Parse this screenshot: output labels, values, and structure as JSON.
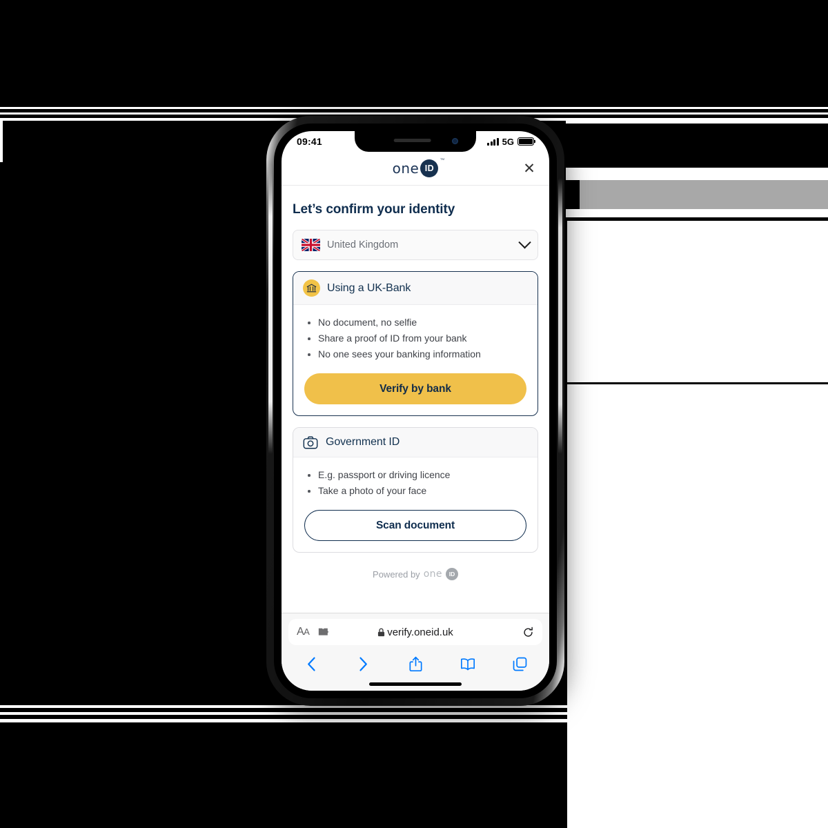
{
  "status_bar": {
    "time": "09:41",
    "network": "5G",
    "signal_icon": "signal-bars-icon",
    "battery_icon": "battery-full-icon"
  },
  "page_header": {
    "logo_word": "one",
    "logo_badge": "ID",
    "logo_tm": "™",
    "close_label": "✕"
  },
  "main": {
    "title": "Let’s confirm your identity",
    "country_select": {
      "value": "United Kingdom",
      "flag_icon": "uk-flag-icon",
      "chevron_icon": "chevron-down-icon"
    },
    "cards": [
      {
        "id": "uk-bank",
        "icon": "bank-icon",
        "title": "Using a UK-Bank",
        "bullets": [
          "No document, no selfie",
          "Share a proof of ID from your bank",
          "No one sees your banking information"
        ],
        "button_label": "Verify by bank",
        "button_style": "primary"
      },
      {
        "id": "government-id",
        "icon": "camera-icon",
        "title": "Government ID",
        "bullets": [
          "E.g. passport or driving licence",
          "Take a photo of your face"
        ],
        "button_label": "Scan document",
        "button_style": "outline"
      }
    ],
    "footer": {
      "powered_text": "Powered by",
      "powered_word": "one",
      "powered_badge": "ID"
    }
  },
  "browser": {
    "text_size_label": "ᴀA",
    "extensions_icon": "puzzle-piece-icon",
    "lock_icon": "lock-icon",
    "url": "verify.oneid.uk",
    "reload_icon": "reload-icon",
    "toolbar": [
      {
        "name": "back",
        "icon": "chevron-left-icon"
      },
      {
        "name": "forward",
        "icon": "chevron-right-icon"
      },
      {
        "name": "share",
        "icon": "share-icon"
      },
      {
        "name": "bookmarks",
        "icon": "book-icon"
      },
      {
        "name": "tabs",
        "icon": "tabs-icon"
      }
    ]
  },
  "colors": {
    "accent_yellow": "#f0c04a",
    "navy": "#0f2d4e",
    "safari_blue": "#007aff",
    "background": "#000000",
    "gray_band": "#a8a8a8"
  }
}
